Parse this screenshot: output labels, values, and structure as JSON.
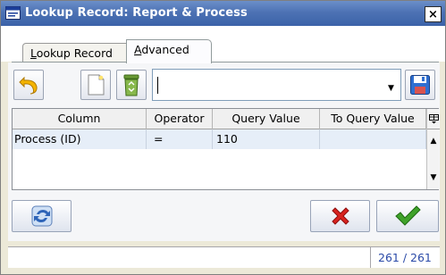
{
  "window": {
    "title": "Lookup Record: Report & Process",
    "close_glyph": "×"
  },
  "tabs": [
    {
      "label_prefix": "",
      "label_underlined": "L",
      "label_suffix": "ookup Record"
    },
    {
      "label_prefix": "",
      "label_underlined": "A",
      "label_suffix": "dvanced"
    }
  ],
  "toolbar": {
    "query_text": ""
  },
  "grid": {
    "columns": [
      "Column",
      "Operator",
      "Query Value",
      "To Query Value"
    ],
    "rows": [
      {
        "column": "Process (ID)",
        "operator": "=",
        "query_value": "110",
        "to_query_value": ""
      }
    ]
  },
  "status": {
    "count": "261 / 261"
  },
  "colors": {
    "title_bar": "#4d72b4",
    "selected_row": "#e6eef8",
    "count_text": "#2b4aa8",
    "cancel_red": "#d8231f",
    "ok_green": "#3fa22a"
  },
  "icons": {
    "undo": "undo-arrow-icon",
    "new": "new-document-icon",
    "delete": "recycle-bin-icon",
    "save": "floppy-disk-icon",
    "refresh": "refresh-icon",
    "cancel": "red-x-icon",
    "ok": "green-checkmark-icon"
  }
}
